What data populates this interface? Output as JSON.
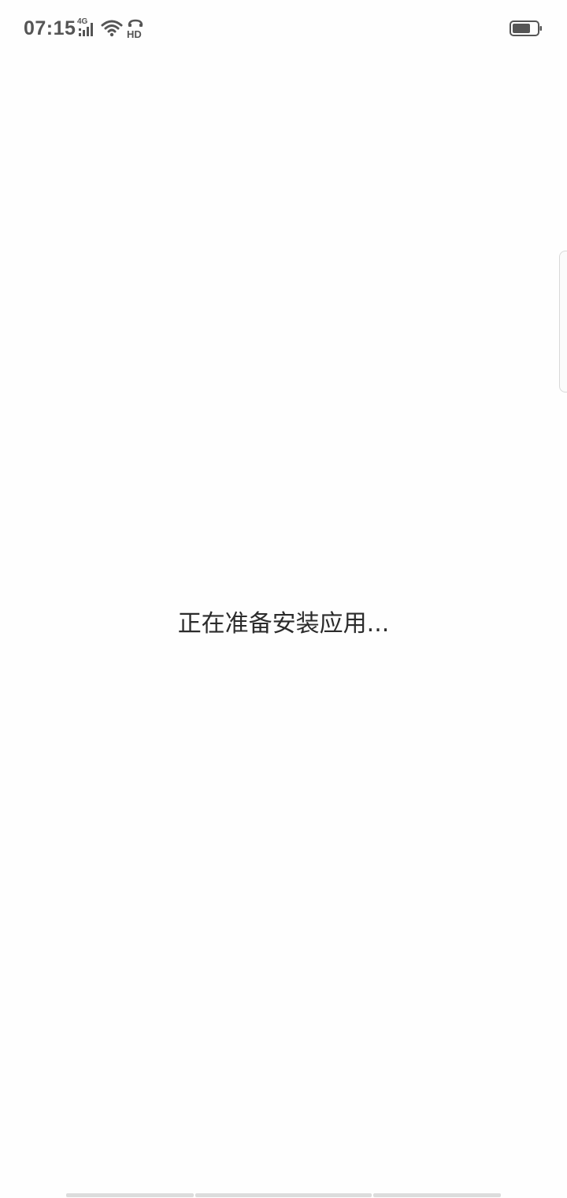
{
  "status_bar": {
    "time": "07:15",
    "network_label": "4G",
    "icons": [
      "signal-4g-icon",
      "wifi-icon",
      "hd-icon",
      "battery-icon"
    ],
    "battery_level": 0.7
  },
  "main": {
    "message": "正在准备安装应用..."
  },
  "colors": {
    "background": "#fefefe",
    "text": "#2b2b2b",
    "status_text": "#555555",
    "nav_bar": "#dcdcdc"
  }
}
